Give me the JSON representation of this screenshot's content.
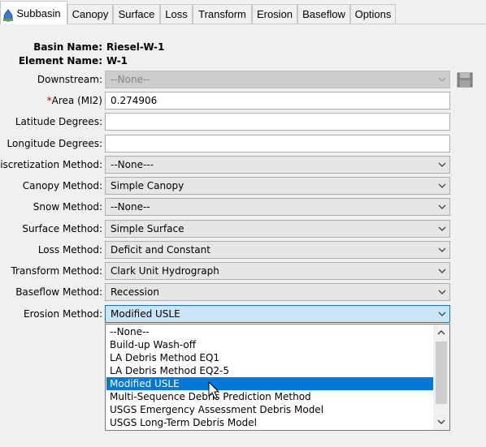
{
  "tabs": [
    {
      "label": "Subbasin",
      "active": true
    },
    {
      "label": "Canopy"
    },
    {
      "label": "Surface"
    },
    {
      "label": "Loss"
    },
    {
      "label": "Transform"
    },
    {
      "label": "Erosion"
    },
    {
      "label": "Baseflow"
    },
    {
      "label": "Options"
    }
  ],
  "header": {
    "basin_name_label": "Basin Name:",
    "basin_name_value": "Riesel-W-1",
    "element_name_label": "Element Name:",
    "element_name_value": "W-1"
  },
  "form": {
    "downstream": {
      "label": "Downstream:",
      "value": "--None--"
    },
    "area": {
      "required_mark": "*",
      "label": "Area (MI2)",
      "value": "0.274906"
    },
    "latitude": {
      "label": "Latitude Degrees:",
      "value": ""
    },
    "longitude": {
      "label": "Longitude Degrees:",
      "value": ""
    },
    "discretization": {
      "label": "Discretization Method:",
      "value": "--None---"
    },
    "canopy": {
      "label": "Canopy Method:",
      "value": "Simple Canopy"
    },
    "snow": {
      "label": "Snow Method:",
      "value": "--None--"
    },
    "surface": {
      "label": "Surface Method:",
      "value": "Simple Surface"
    },
    "loss": {
      "label": "Loss Method:",
      "value": "Deficit and Constant"
    },
    "transform": {
      "label": "Transform Method:",
      "value": "Clark Unit Hydrograph"
    },
    "baseflow": {
      "label": "Baseflow Method:",
      "value": "Recession"
    },
    "erosion": {
      "label": "Erosion Method:",
      "value": "Modified USLE"
    }
  },
  "erosion_options": [
    "--None--",
    "Build-up Wash-off",
    "LA Debris Method EQ1",
    "LA Debris Method EQ2-5",
    "Modified USLE",
    "Multi-Sequence Debris Prediction Method",
    "USGS Emergency Assessment Debris Model",
    "USGS Long-Term Debris Model"
  ],
  "erosion_selected": "Modified USLE",
  "colors": {
    "selection": "#0078d7",
    "focused_combo": "#cce4f7",
    "required": "#d00000"
  },
  "icons": {
    "subbasin_tab": "subbasin-icon",
    "downstream_side": "save-disk-icon"
  }
}
